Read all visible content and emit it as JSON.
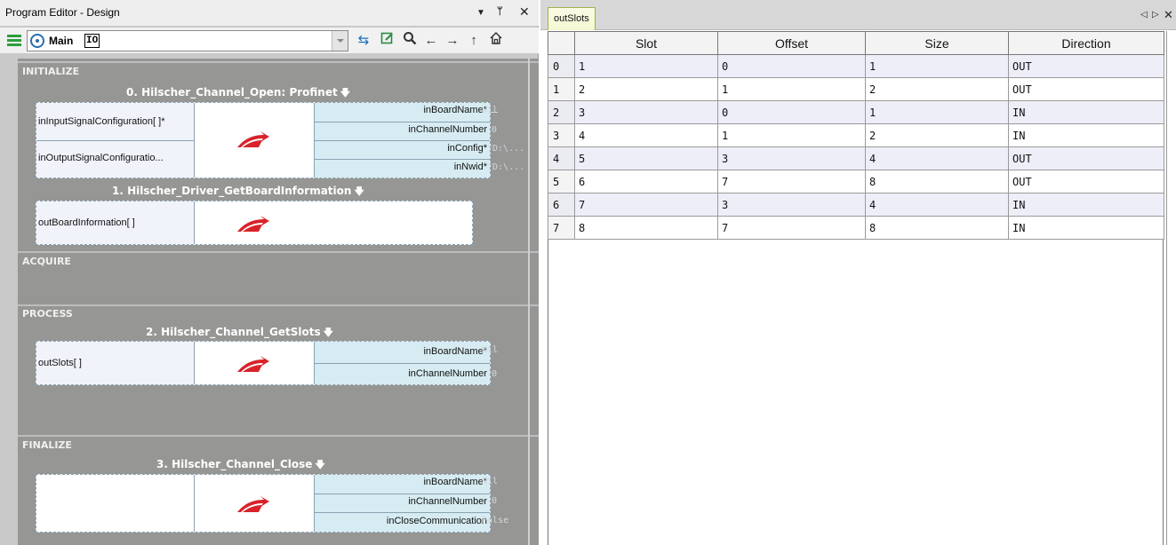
{
  "editor": {
    "title": "Program Editor - Design",
    "program": {
      "name": "Main",
      "tag": "IO"
    },
    "sections": [
      {
        "label": "INITIALIZE"
      },
      {
        "label": "ACQUIRE"
      },
      {
        "label": "PROCESS"
      },
      {
        "label": "FINALIZE"
      }
    ],
    "blocks": [
      {
        "title": "0. Hilscher_Channel_Open: Profinet",
        "inputs": [
          "inInputSignalConfiguration[ ]*",
          "inOutputSignalConfiguratio..."
        ],
        "outputs": [
          "inBoardName*",
          "inChannelNumber",
          "inConfig*",
          "inNwid*"
        ],
        "values": [
          "Nil",
          "0",
          "\"D:\\...",
          "\"D:\\..."
        ]
      },
      {
        "title": "1. Hilscher_Driver_GetBoardInformation",
        "inputs": [
          "outBoardInformation[ ]"
        ],
        "outputs": [],
        "values": []
      },
      {
        "title": "2. Hilscher_Channel_GetSlots",
        "inputs": [
          "outSlots[ ]"
        ],
        "outputs": [
          "inBoardName*",
          "inChannelNumber"
        ],
        "values": [
          "Nil",
          "0"
        ]
      },
      {
        "title": "3. Hilscher_Channel_Close",
        "inputs": [],
        "outputs": [
          "inBoardName*",
          "inChannelNumber",
          "inCloseCommunication"
        ],
        "values": [
          "Nil",
          "0",
          "False"
        ]
      }
    ]
  },
  "viewer": {
    "tab_label": "outSlots",
    "columns": [
      "Slot",
      "Offset",
      "Size",
      "Direction"
    ],
    "rows": [
      {
        "index": "0",
        "slot": "1",
        "offset": "0",
        "size": "1",
        "direction": "OUT"
      },
      {
        "index": "1",
        "slot": "2",
        "offset": "1",
        "size": "2",
        "direction": "OUT"
      },
      {
        "index": "2",
        "slot": "3",
        "offset": "0",
        "size": "1",
        "direction": "IN"
      },
      {
        "index": "3",
        "slot": "4",
        "offset": "1",
        "size": "2",
        "direction": "IN"
      },
      {
        "index": "4",
        "slot": "5",
        "offset": "3",
        "size": "4",
        "direction": "OUT"
      },
      {
        "index": "5",
        "slot": "6",
        "offset": "7",
        "size": "8",
        "direction": "OUT"
      },
      {
        "index": "6",
        "slot": "7",
        "offset": "3",
        "size": "4",
        "direction": "IN"
      },
      {
        "index": "7",
        "slot": "8",
        "offset": "7",
        "size": "8",
        "direction": "IN"
      }
    ]
  },
  "icons": {
    "menu": "hamburger-menu-icon",
    "gear": "program-gear-icon",
    "sync": "sync-arrows-icon",
    "edit": "edit-icon",
    "search": "search-icon",
    "back": "arrow-left-icon",
    "forward": "arrow-right-icon",
    "up": "arrow-up-icon",
    "home": "home-icon",
    "block_logo": "hilscher-logo-icon"
  },
  "colors": {
    "canvas": "#969694",
    "block_right": "#d6ecf2",
    "logo_red": "#d9232a",
    "menu_green": "#2e9e3e",
    "tab_border": "#9fb24a"
  }
}
